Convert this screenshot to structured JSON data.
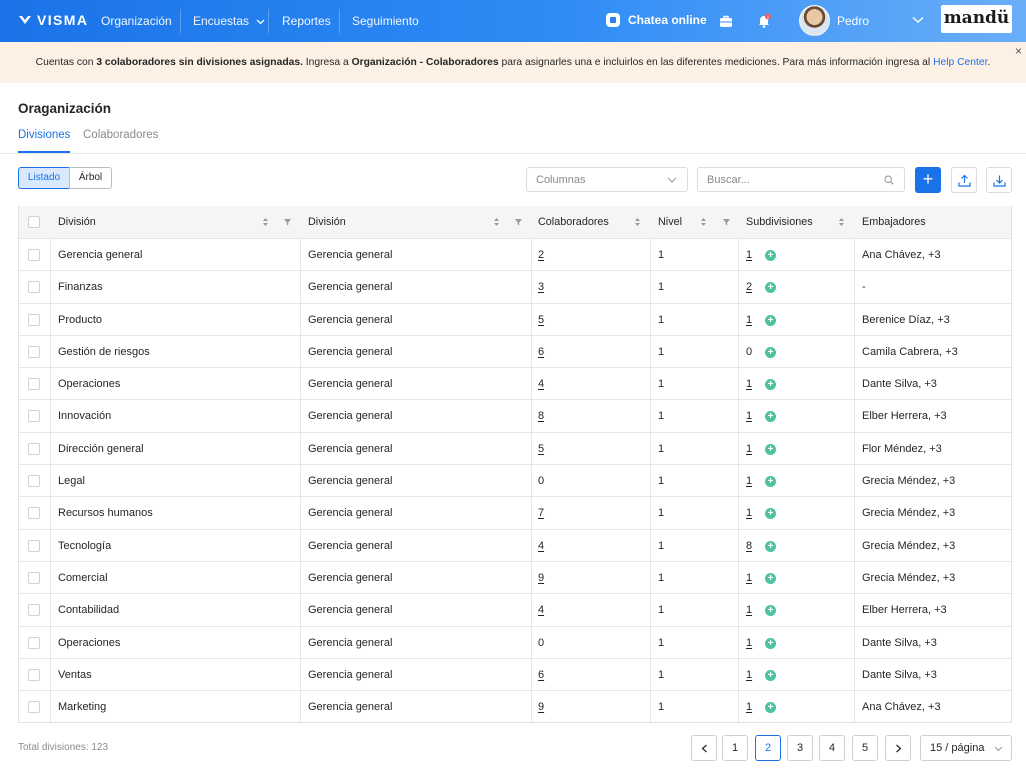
{
  "topbar": {
    "brand": "VISMA",
    "nav": [
      "Organización",
      "Encuestas",
      "Reportes",
      "Seguimiento"
    ],
    "chat_label": "Chatea online",
    "notification_count": "1",
    "user_name": "Pedro",
    "logo_text": "mandü",
    "icons": [
      "visma-logo-icon",
      "chevron-down-icon",
      "chat-icon",
      "briefcase-icon",
      "bell-icon",
      "avatar",
      "chevron-down-icon"
    ]
  },
  "banner": {
    "text_1": "Cuentas con ",
    "bold_1": "3 colaboradores sin divisiones asignadas.",
    "text_2": " Ingresa a ",
    "bold_2": "Organización - Colaboradores",
    "text_3": " para asignarles una e incluirlos en las diferentes mediciones. Para más información ingresa al ",
    "link": "Help Center",
    "text_4": ".",
    "close": "×"
  },
  "page": {
    "title": "Oraganización",
    "tabs": [
      "Divisiones",
      "Colaboradores"
    ],
    "active_tab": "Divisiones"
  },
  "toolbar": {
    "view_options": [
      "Listado",
      "Árbol"
    ],
    "active_view": "Listado",
    "columns_placeholder": "Columnas",
    "search_placeholder": "Buscar...",
    "add_label": "+"
  },
  "table": {
    "headers": [
      "División",
      "División",
      "Colaboradores",
      "Nivel",
      "Subdivisiones",
      "Embajadores"
    ],
    "rows": [
      {
        "division": "Gerencia general",
        "parent": "Gerencia general",
        "colaboradores": "2",
        "colab_link": true,
        "nivel": "1",
        "subdivisiones": "1",
        "sub_link": true,
        "embajadores": "Ana Chávez, +3"
      },
      {
        "division": "Finanzas",
        "parent": "Gerencia general",
        "colaboradores": "3",
        "colab_link": true,
        "nivel": "1",
        "subdivisiones": "2",
        "sub_link": true,
        "embajadores": "-"
      },
      {
        "division": "Producto",
        "parent": "Gerencia general",
        "colaboradores": "5",
        "colab_link": true,
        "nivel": "1",
        "subdivisiones": "1",
        "sub_link": true,
        "embajadores": "Berenice Díaz, +3"
      },
      {
        "division": "Gestión de riesgos",
        "parent": "Gerencia general",
        "colaboradores": "6",
        "colab_link": true,
        "nivel": "1",
        "subdivisiones": "0",
        "sub_link": false,
        "embajadores": "Camila Cabrera, +3"
      },
      {
        "division": "Operaciones",
        "parent": "Gerencia general",
        "colaboradores": "4",
        "colab_link": true,
        "nivel": "1",
        "subdivisiones": "1",
        "sub_link": true,
        "embajadores": "Dante Silva, +3"
      },
      {
        "division": "Innovación",
        "parent": "Gerencia general",
        "colaboradores": "8",
        "colab_link": true,
        "nivel": "1",
        "subdivisiones": "1",
        "sub_link": true,
        "embajadores": "Elber Herrera, +3"
      },
      {
        "division": "Dirección general",
        "parent": "Gerencia general",
        "colaboradores": "5",
        "colab_link": true,
        "nivel": "1",
        "subdivisiones": "1",
        "sub_link": true,
        "embajadores": "Flor Méndez, +3"
      },
      {
        "division": "Legal",
        "parent": "Gerencia general",
        "colaboradores": "0",
        "colab_link": false,
        "nivel": "1",
        "subdivisiones": "1",
        "sub_link": true,
        "embajadores": "Grecia Méndez, +3"
      },
      {
        "division": "Recursos humanos",
        "parent": "Gerencia general",
        "colaboradores": "7",
        "colab_link": true,
        "nivel": "1",
        "subdivisiones": "1",
        "sub_link": true,
        "embajadores": "Grecia Méndez, +3"
      },
      {
        "division": "Tecnología",
        "parent": "Gerencia general",
        "colaboradores": "4",
        "colab_link": true,
        "nivel": "1",
        "subdivisiones": "8",
        "sub_link": true,
        "embajadores": "Grecia Méndez, +3"
      },
      {
        "division": "Comercial",
        "parent": "Gerencia general",
        "colaboradores": "9",
        "colab_link": true,
        "nivel": "1",
        "subdivisiones": "1",
        "sub_link": true,
        "embajadores": "Grecia Méndez, +3"
      },
      {
        "division": "Contabilidad",
        "parent": "Gerencia general",
        "colaboradores": "4",
        "colab_link": true,
        "nivel": "1",
        "subdivisiones": "1",
        "sub_link": true,
        "embajadores": "Elber Herrera, +3"
      },
      {
        "division": "Operaciones",
        "parent": "Gerencia general",
        "colaboradores": "0",
        "colab_link": false,
        "nivel": "1",
        "subdivisiones": "1",
        "sub_link": true,
        "embajadores": "Dante Silva, +3"
      },
      {
        "division": "Ventas",
        "parent": "Gerencia general",
        "colaboradores": "6",
        "colab_link": true,
        "nivel": "1",
        "subdivisiones": "1",
        "sub_link": true,
        "embajadores": "Dante Silva, +3"
      },
      {
        "division": "Marketing",
        "parent": "Gerencia general",
        "colaboradores": "9",
        "colab_link": true,
        "nivel": "1",
        "subdivisiones": "1",
        "sub_link": true,
        "embajadores": "Ana Chávez, +3"
      }
    ]
  },
  "footer": {
    "total_label": "Total divisiones: 123",
    "pages": [
      "1",
      "2",
      "3",
      "4",
      "5"
    ],
    "current_page": "2",
    "per_page": "15 / página"
  },
  "colors": {
    "primary": "#1a73e8",
    "banner_bg": "#fdf1e5",
    "add_green": "#4cc3a0",
    "header_bg": "#f5f5f5"
  }
}
